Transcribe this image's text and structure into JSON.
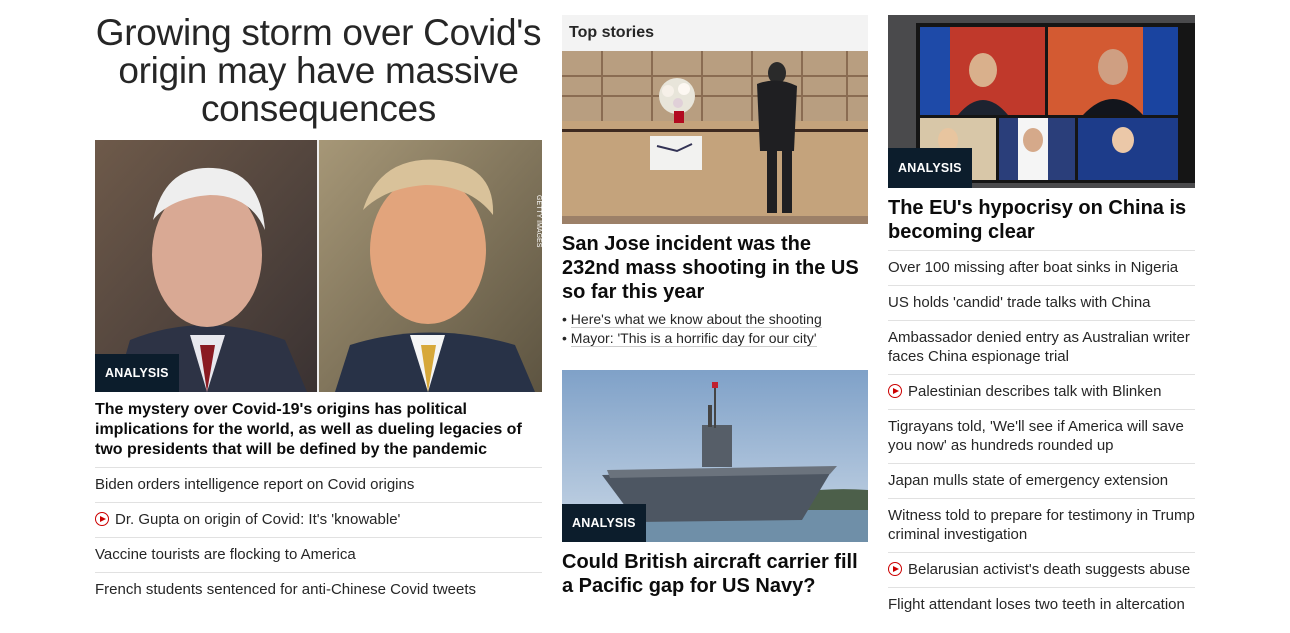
{
  "col1": {
    "headline": "Growing storm over Covid's origin may have massive consequences",
    "image_credit": "GETTY IMAGES",
    "badge": "ANALYSIS",
    "summary": "The mystery over Covid-19's origins has political implications for the world, as well as dueling legacies of two presidents that will be defined by the pandemic",
    "links": [
      {
        "text": "Biden orders intelligence report on Covid origins",
        "video": false
      },
      {
        "text": "Dr. Gupta on origin of Covid: It's 'knowable'",
        "video": true
      },
      {
        "text": "Vaccine tourists are flocking to America",
        "video": false
      },
      {
        "text": "French students sentenced for anti-Chinese Covid tweets",
        "video": false
      }
    ]
  },
  "col2": {
    "section_label": "Top stories",
    "story1": {
      "headline": "San Jose incident was the 232nd mass shooting in the US so far this year",
      "bullets": [
        "Here's what we know about the shooting",
        "Mayor: 'This is a horrific day for our city'"
      ]
    },
    "story2": {
      "badge": "ANALYSIS",
      "headline": "Could British aircraft carrier fill a Pacific gap for US Navy?"
    }
  },
  "col3": {
    "badge": "ANALYSIS",
    "headline": "The EU's hypocrisy on China is becoming clear",
    "links": [
      {
        "text": "Over 100 missing after boat sinks in Nigeria",
        "video": false
      },
      {
        "text": "US holds 'candid' trade talks with China",
        "video": false
      },
      {
        "text": "Ambassador denied entry as Australian writer faces China espionage trial",
        "video": false
      },
      {
        "text": "Palestinian describes talk with Blinken",
        "video": true
      },
      {
        "text": "Tigrayans told, 'We'll see if America will save you now' as hundreds rounded up",
        "video": false
      },
      {
        "text": "Japan mulls state of emergency extension",
        "video": false
      },
      {
        "text": "Witness told to prepare for testimony in Trump criminal investigation",
        "video": false
      },
      {
        "text": "Belarusian activist's death suggests abuse",
        "video": true
      },
      {
        "text": "Flight attendant loses two teeth in altercation",
        "video": false
      }
    ]
  },
  "colors": {
    "badge_bg": "#0c1d2c",
    "video_icon": "#cc0000",
    "section_label_bg": "#f3f3f3"
  }
}
